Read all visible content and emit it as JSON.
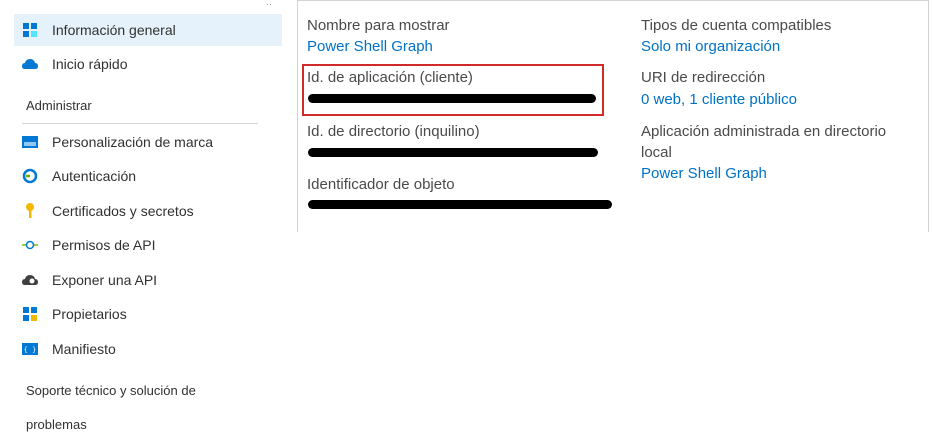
{
  "sidebar": {
    "top_items": [
      {
        "label": "Información general",
        "icon": "overview-grid-icon"
      },
      {
        "label": "Inicio rápido",
        "icon": "cloud-icon"
      }
    ],
    "section_manage": "Administrar",
    "manage_items": [
      {
        "label": "Personalización de marca",
        "icon": "branding-icon"
      },
      {
        "label": "Autenticación",
        "icon": "authentication-icon"
      },
      {
        "label": "Certificados y secretos",
        "icon": "key-icon"
      },
      {
        "label": "Permisos de API",
        "icon": "api-permissions-icon"
      },
      {
        "label": "Exponer una API",
        "icon": "cloud-gear-icon"
      },
      {
        "label": "Propietarios",
        "icon": "owners-grid-icon"
      },
      {
        "label": "Manifiesto",
        "icon": "manifest-icon"
      }
    ],
    "section_support_line1": "Soporte técnico y solución de",
    "section_support_line2": "problemas"
  },
  "essentials": {
    "display_name_label": "Nombre para mostrar",
    "display_name_value": "Power Shell Graph",
    "app_id_label": "Id. de aplicación (cliente)",
    "directory_id_label": "Id. de directorio (inquilino)",
    "object_id_label": "Identificador de objeto",
    "account_types_label": "Tipos de cuenta compatibles",
    "account_types_value": "Solo mi organización",
    "redirect_uri_label": "URI de redirección",
    "redirect_uri_value": "0 web, 1 cliente público",
    "managed_app_label_line1": "Aplicación administrada en directorio",
    "managed_app_label_line2": "local",
    "managed_app_value": "Power Shell Graph"
  },
  "colors": {
    "link": "#0072c6",
    "active_bg": "#e6f2fb",
    "highlight_border": "#d12a2a"
  }
}
